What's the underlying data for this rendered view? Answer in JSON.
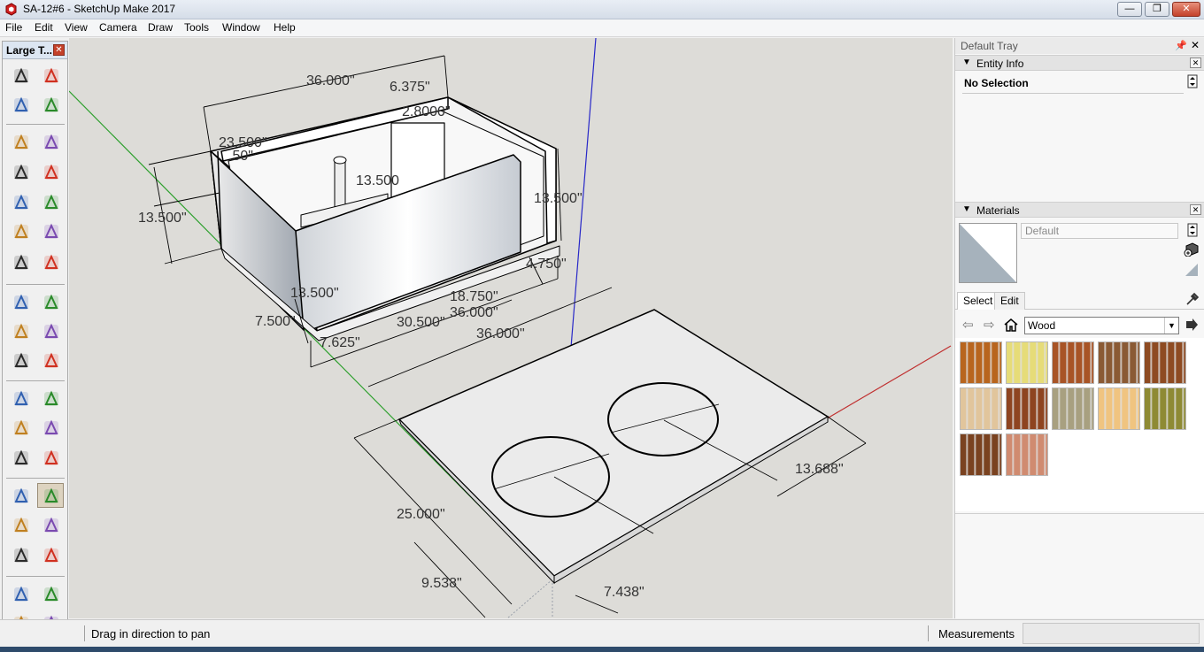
{
  "window": {
    "title": "SA-12#6 - SketchUp Make 2017",
    "min_label": "—",
    "restore_label": "❐",
    "close_label": "✕"
  },
  "menu": [
    "File",
    "Edit",
    "View",
    "Camera",
    "Draw",
    "Tools",
    "Window",
    "Help"
  ],
  "toolbar": {
    "title": "Large T...",
    "close_label": "✕",
    "tools": [
      "select-tool",
      "component-tool",
      "paint-bucket-tool",
      "eraser-tool",
      "line-tool",
      "freehand-tool",
      "rectangle-tool",
      "rotated-rectangle-tool",
      "circle-tool",
      "polygon-tool",
      "arc-tool",
      "two-point-arc-tool",
      "three-point-arc-tool",
      "pie-tool",
      "move-tool",
      "push-pull-tool",
      "rotate-tool",
      "follow-me-tool",
      "scale-tool",
      "offset-tool",
      "tape-measure-tool",
      "dimension-tool",
      "protractor-tool",
      "text-tool",
      "axes-tool",
      "3d-text-tool",
      "orbit-tool",
      "pan-tool",
      "zoom-tool",
      "zoom-window-tool",
      "zoom-extents-tool",
      "previous-view-tool",
      "position-camera-tool",
      "look-around-tool",
      "walk-tool",
      "section-plane-tool"
    ],
    "active_tool": "pan-tool"
  },
  "viewport": {
    "dimensions": {
      "box_width_top": "36.000\"",
      "box_depth_top": "6.375\"",
      "port_inner": "2.8000\"",
      "box_depth": "23.500\"",
      "small_left": ".50\"",
      "height_left": "13.500\"",
      "port_height": "13.500",
      "height_right": "13.500\"",
      "front_height": "13.500\"",
      "side_offset": "4.750\"",
      "inner_len": "18.750\"",
      "inner_len2": "36.000\"",
      "bottom_left": "7.500\"",
      "bottom_a": "7.625\"",
      "bottom_b": "30.500\"",
      "bottom_total": "36.000\"",
      "board_depth": "25.000\"",
      "board_right": "13.688\"",
      "hole_offset_left": "9.538\"",
      "hole_offset_right": "7.438\""
    },
    "axis_colors": {
      "green": "#2ea02e",
      "red": "#c03030",
      "blue": "#2828c8"
    }
  },
  "tray": {
    "title": "Default Tray",
    "pin_label": "📌",
    "close_label": "✕",
    "entity_info": {
      "title": "Entity Info",
      "selection": "No Selection"
    },
    "materials": {
      "title": "Materials",
      "current_name": "Default",
      "tabs": [
        "Select",
        "Edit"
      ],
      "library": "Wood",
      "swatches": [
        {
          "name": "wood-cherry",
          "color": "#b8651e"
        },
        {
          "name": "wood-light-yellow",
          "color": "#e6dc78"
        },
        {
          "name": "wood-red-brown",
          "color": "#a85426"
        },
        {
          "name": "wood-walnut",
          "color": "#8a5a34"
        },
        {
          "name": "wood-parquet-dark",
          "color": "#8e4b22"
        },
        {
          "name": "wood-parquet-light",
          "color": "#e1c59c"
        },
        {
          "name": "wood-parquet-mahogany",
          "color": "#8e4420"
        },
        {
          "name": "wood-grey-oak",
          "color": "#a8a080"
        },
        {
          "name": "wood-particle-board",
          "color": "#f0c480"
        },
        {
          "name": "wood-olive",
          "color": "#8e8a34"
        },
        {
          "name": "wood-dark-walnut",
          "color": "#7a4220"
        },
        {
          "name": "wood-salmon",
          "color": "#d08b70"
        }
      ]
    }
  },
  "status": {
    "hint": "Drag in direction to pan",
    "measurements_label": "Measurements",
    "measurements_value": ""
  }
}
